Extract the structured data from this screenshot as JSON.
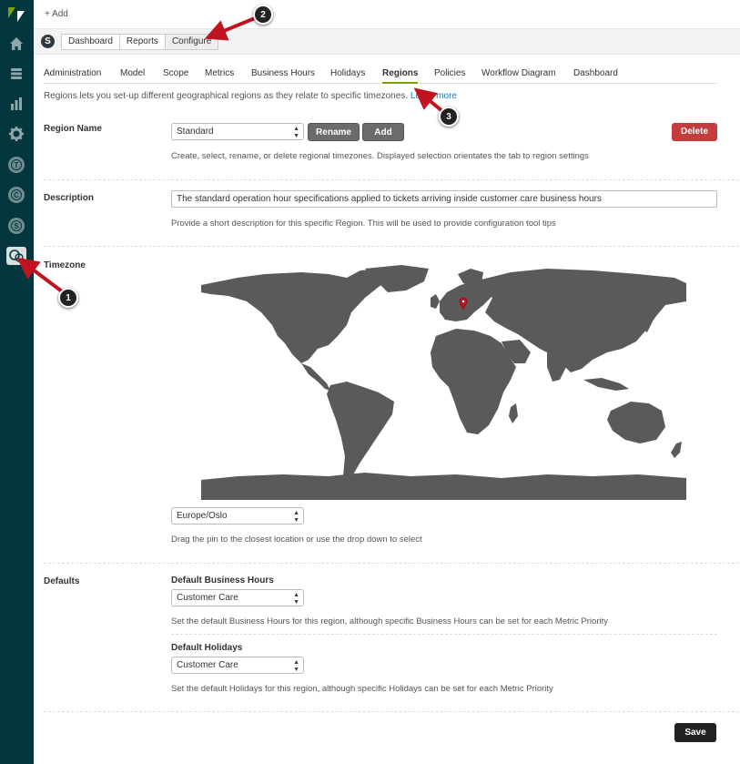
{
  "topbar": {
    "add_label": "+ Add"
  },
  "app": {
    "logo_letter": "S",
    "tabs": [
      "Dashboard",
      "Reports",
      "Configure"
    ]
  },
  "sidebar": {
    "icons": [
      "home-icon",
      "views-icon",
      "reporting-icon",
      "admin-gear-icon",
      "app-t-icon",
      "app-c-icon",
      "app-s-icon",
      "sla-app-icon"
    ],
    "letters": {
      "t": "T",
      "c": "C",
      "s": "S"
    }
  },
  "tabs": [
    "Administration",
    "Model",
    "Scope",
    "Metrics",
    "Business Hours",
    "Holidays",
    "Regions",
    "Policies",
    "Workflow Diagram",
    "Dashboard"
  ],
  "intro": {
    "text": "Regions lets you set-up different geographical regions as they relate to specific timezones.",
    "link": "Learn more"
  },
  "region_name": {
    "label": "Region Name",
    "selected": "Standard",
    "rename": "Rename",
    "add": "Add",
    "delete": "Delete",
    "help": "Create, select, rename, or delete regional timezones. Displayed selection orientates the tab to region settings"
  },
  "description": {
    "label": "Description",
    "value": "The standard operation hour specifications applied to tickets arriving inside customer care business hours",
    "help": "Provide a short description for this specific Region. This will be used to provide configuration tool tips"
  },
  "timezone": {
    "label": "Timezone",
    "selected": "Europe/Oslo",
    "help": "Drag the pin to the closest location or use the drop down to select"
  },
  "defaults": {
    "label": "Defaults",
    "business_hours_label": "Default Business Hours",
    "business_hours_value": "Customer Care",
    "business_hours_help": "Set the default Business Hours for this region, although specific Business Hours can be set for each Metric Priority",
    "holidays_label": "Default Holidays",
    "holidays_value": "Customer Care",
    "holidays_help": "Set the default Holidays for this region, although specific Holidays can be set for each Metric Priority"
  },
  "save": "Save",
  "callouts": [
    "1",
    "2",
    "3"
  ],
  "colors": {
    "sidebar": "#03363d",
    "accent": "#78a300",
    "delete": "#c63b3b",
    "arrow": "#c1121f",
    "map_land": "#5a5a5a"
  }
}
